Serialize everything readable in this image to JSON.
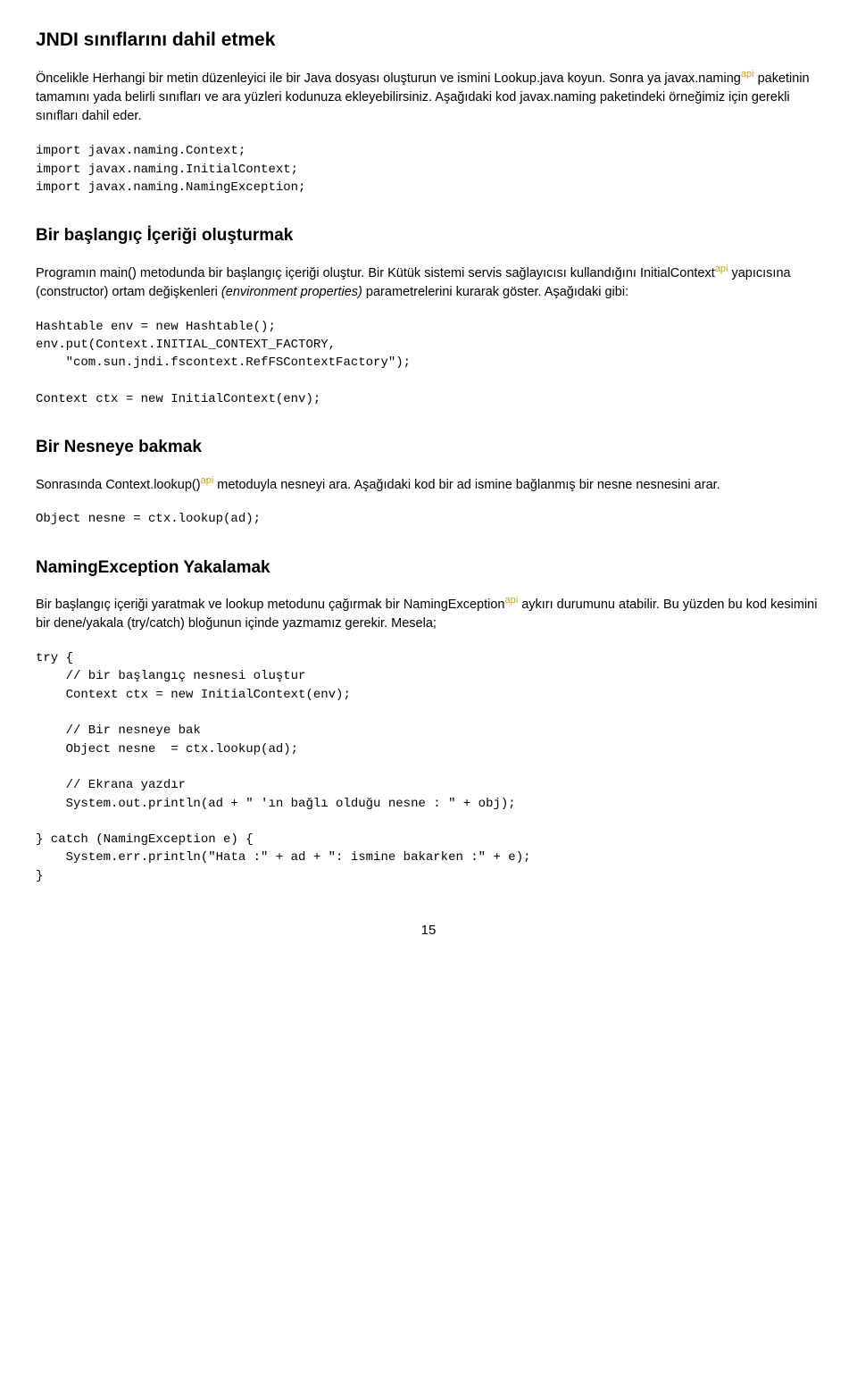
{
  "section1": {
    "heading": "JNDI sınıflarını dahil etmek",
    "para1a": "Öncelikle Herhangi bir metin düzenleyici ile bir Java dosyası oluşturun ve ismini Lookup.java koyun. Sonra ya javax.naming",
    "para1b": " paketinin tamamını yada belirli sınıfları ve ara yüzleri kodunuza ekleyebilirsiniz. Aşağıdaki kod javax.naming paketindeki örneğimiz için gerekli sınıfları dahil eder.",
    "code1": "import javax.naming.Context;\nimport javax.naming.InitialContext;\nimport javax.naming.NamingException;"
  },
  "section2": {
    "heading": "Bir başlangıç İçeriği oluşturmak",
    "para1a": "Programın main() metodunda bir başlangıç içeriği oluştur. Bir Kütük sistemi servis sağlayıcısı kullandığını InitialContext",
    "para1b": " yapıcısına (constructor) ortam değişkenleri ",
    "para1c": "(environment properties)",
    "para1d": "  parametrelerini kurarak göster. Aşağıdaki gibi:",
    "code1": "Hashtable env = new Hashtable();\nenv.put(Context.INITIAL_CONTEXT_FACTORY,\n    \"com.sun.jndi.fscontext.RefFSContextFactory\");\n\nContext ctx = new InitialContext(env);"
  },
  "section3": {
    "heading": "Bir Nesneye bakmak",
    "para1a": "Sonrasında Context.lookup()",
    "para1b": " metoduyla nesneyi ara. Aşağıdaki kod bir ad ismine bağlanmış bir nesne nesnesini arar.",
    "code1": "Object nesne = ctx.lookup(ad);"
  },
  "section4": {
    "heading": "NamingException Yakalamak",
    "para1a": "Bir başlangıç içeriği yaratmak ve lookup metodunu çağırmak bir NamingException",
    "para1b": " aykırı durumunu atabilir. Bu yüzden bu kod kesimini bir dene/yakala (try/catch) bloğunun içinde yazmamız gerekir. Mesela;",
    "code1": "try {\n    // bir başlangıç nesnesi oluştur\n    Context ctx = new InitialContext(env);\n\n    // Bir nesneye bak\n    Object nesne  = ctx.lookup(ad);\n\n    // Ekrana yazdır\n    System.out.println(ad + \" 'ın bağlı olduğu nesne : \" + obj);\n\n} catch (NamingException e) {\n    System.err.println(\"Hata :\" + ad + \": ismine bakarken :\" + e);\n}"
  },
  "api_label": "api",
  "page_number": "15"
}
